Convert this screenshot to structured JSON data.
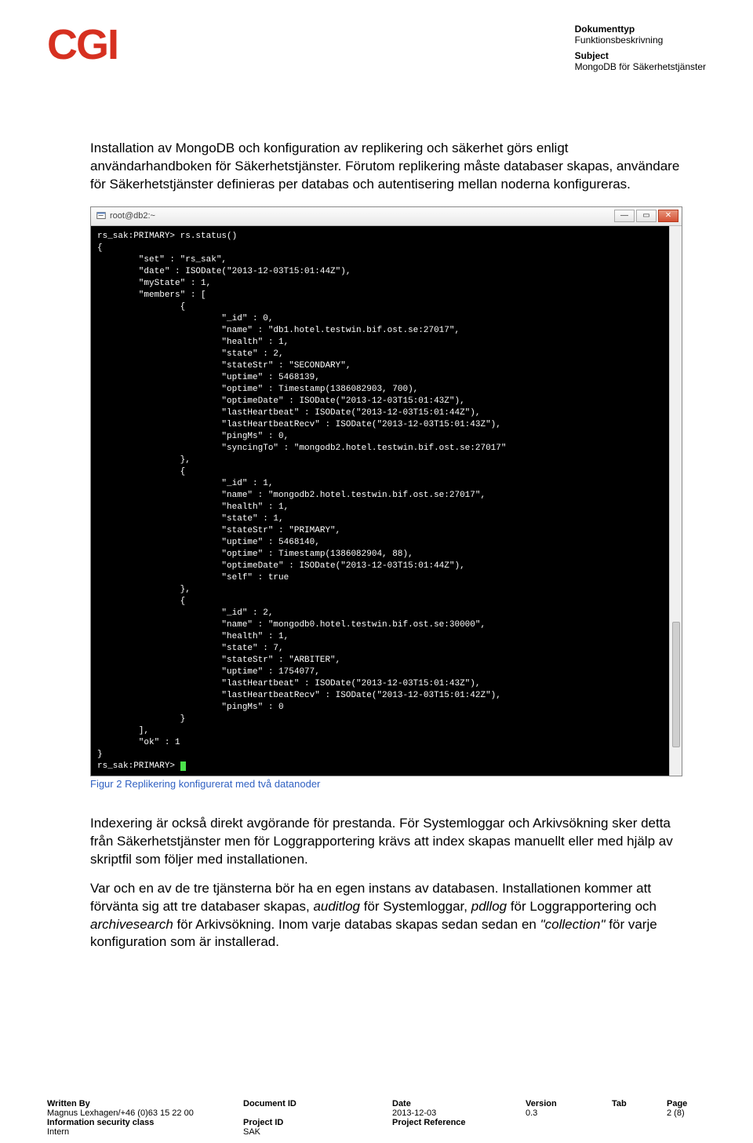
{
  "header": {
    "logo_text": "CGI",
    "doc_type_label": "Dokumenttyp",
    "doc_type_value": "Funktionsbeskrivning",
    "subject_label": "Subject",
    "subject_value": "MongoDB för Säkerhetstjänster"
  },
  "body": {
    "para1": "Installation av MongoDB och konfiguration av replikering och säkerhet görs enligt användarhandboken för Säkerhetstjänster. Förutom replikering måste databaser skapas, användare för Säkerhetstjänster definieras per databas och autentisering mellan noderna konfigureras.",
    "figure_caption": "Figur 2 Replikering konfigurerat med två datanoder",
    "para2_pre": "Indexering är också direkt avgörande för prestanda. För Systemloggar och Arkivsökning sker detta från Säkerhetstjänster men för Loggrapportering krävs att index skapas manuellt eller med hjälp av skriptfil som följer med installationen.",
    "para3_part1": "Var och en av de tre tjänsterna bör ha en egen instans av databasen. Installationen kommer att förvänta sig att tre databaser skapas, ",
    "para3_em1": "auditlog",
    "para3_part2": " för Systemloggar, ",
    "para3_em2": "pdllog",
    "para3_part3": " för Loggrapportering och ",
    "para3_em3": "archivesearch",
    "para3_part4": " för Arkivsökning. Inom varje databas skapas sedan sedan en ",
    "para3_em4": "\"collection\"",
    "para3_part5": " för varje konfiguration som är installerad."
  },
  "terminal": {
    "title": "root@db2:~",
    "prompt_line": "rs_sak:PRIMARY> rs.status()",
    "content": "{\n        \"set\" : \"rs_sak\",\n        \"date\" : ISODate(\"2013-12-03T15:01:44Z\"),\n        \"myState\" : 1,\n        \"members\" : [\n                {\n                        \"_id\" : 0,\n                        \"name\" : \"db1.hotel.testwin.bif.ost.se:27017\",\n                        \"health\" : 1,\n                        \"state\" : 2,\n                        \"stateStr\" : \"SECONDARY\",\n                        \"uptime\" : 5468139,\n                        \"optime\" : Timestamp(1386082903, 700),\n                        \"optimeDate\" : ISODate(\"2013-12-03T15:01:43Z\"),\n                        \"lastHeartbeat\" : ISODate(\"2013-12-03T15:01:44Z\"),\n                        \"lastHeartbeatRecv\" : ISODate(\"2013-12-03T15:01:43Z\"),\n                        \"pingMs\" : 0,\n                        \"syncingTo\" : \"mongodb2.hotel.testwin.bif.ost.se:27017\"\n                },\n                {\n                        \"_id\" : 1,\n                        \"name\" : \"mongodb2.hotel.testwin.bif.ost.se:27017\",\n                        \"health\" : 1,\n                        \"state\" : 1,\n                        \"stateStr\" : \"PRIMARY\",\n                        \"uptime\" : 5468140,\n                        \"optime\" : Timestamp(1386082904, 88),\n                        \"optimeDate\" : ISODate(\"2013-12-03T15:01:44Z\"),\n                        \"self\" : true\n                },\n                {\n                        \"_id\" : 2,\n                        \"name\" : \"mongodb0.hotel.testwin.bif.ost.se:30000\",\n                        \"health\" : 1,\n                        \"state\" : 7,\n                        \"stateStr\" : \"ARBITER\",\n                        \"uptime\" : 1754077,\n                        \"lastHeartbeat\" : ISODate(\"2013-12-03T15:01:43Z\"),\n                        \"lastHeartbeatRecv\" : ISODate(\"2013-12-03T15:01:42Z\"),\n                        \"pingMs\" : 0\n                }\n        ],\n        \"ok\" : 1\n}",
    "end_prompt": "rs_sak:PRIMARY> "
  },
  "window_buttons": {
    "minimize": "—",
    "maximize": "▭",
    "close": "✕"
  },
  "footer": {
    "written_by_label": "Written By",
    "written_by_value": "Magnus Lexhagen/+46 (0)63 15 22 00",
    "info_class_label": "Information security class",
    "info_class_value": "Intern",
    "doc_id_label": "Document ID",
    "project_id_label": "Project ID",
    "project_id_value": "SAK",
    "date_label": "Date",
    "date_value": "2013-12-03",
    "project_ref_label": "Project Reference",
    "version_label": "Version",
    "version_value": "0.3",
    "tab_label": "Tab",
    "page_label": "Page",
    "page_value": "2 (8)"
  }
}
